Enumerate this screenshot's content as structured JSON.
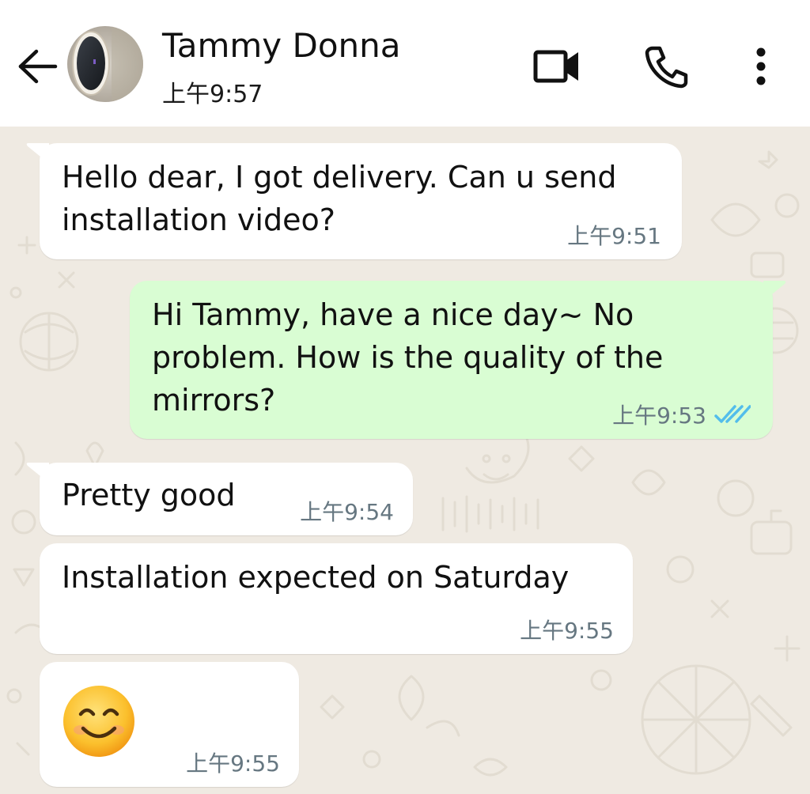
{
  "header": {
    "contact_name": "Tammy Donna",
    "last_seen": "上午9:57",
    "icons": {
      "back": "arrow-left-icon",
      "video": "video-camera-icon",
      "call": "phone-icon",
      "menu": "more-vertical-icon"
    }
  },
  "messages": [
    {
      "direction": "incoming",
      "lines": [
        "Hello dear, I got delivery. Can u send",
        "installation video?"
      ],
      "time": "上午9:51"
    },
    {
      "direction": "outgoing",
      "lines": [
        "Hi Tammy, have a nice day~ No",
        "problem. How is the quality of the",
        "mirrors?"
      ],
      "time": "上午9:53",
      "status": "read",
      "status_icon": "double-check-icon"
    },
    {
      "direction": "incoming",
      "lines": [
        "Pretty good"
      ],
      "time": "上午9:54"
    },
    {
      "direction": "incoming",
      "lines": [
        "Installation expected on Saturday"
      ],
      "time": "上午9:55"
    },
    {
      "direction": "incoming",
      "emoji": "smiling-face-icon",
      "time": "上午9:55"
    }
  ],
  "colors": {
    "header_bg": "#ffffff",
    "chat_bg": "#efeae2",
    "incoming_bubble": "#ffffff",
    "outgoing_bubble": "#d9fdd3",
    "read_ticks": "#53bdeb",
    "timestamp": "#667781"
  }
}
